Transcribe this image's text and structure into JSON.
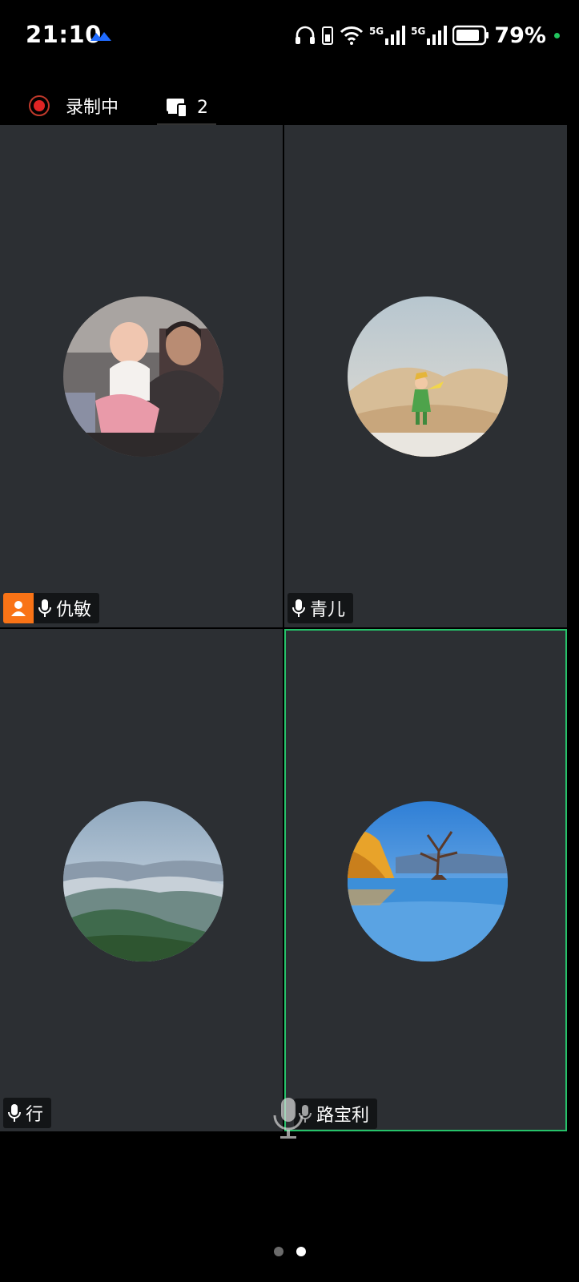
{
  "status_bar": {
    "time": "21:10",
    "battery_percent": "79%",
    "network_1": "5G",
    "network_2": "5G"
  },
  "meeting_bar": {
    "recording_label": "录制中",
    "share_count": "2"
  },
  "participants": [
    {
      "name": "仇敏",
      "is_host": true,
      "speaking": false
    },
    {
      "name": "青儿",
      "is_host": false,
      "speaking": false
    },
    {
      "name": "行",
      "is_host": false,
      "speaking": false
    },
    {
      "name": "路宝利",
      "is_host": false,
      "speaking": true
    }
  ],
  "pager": {
    "total_pages": 2,
    "current_page": 2
  },
  "colors": {
    "tile_bg": "#2c2f33",
    "active_border": "#26c26a",
    "host_badge": "#f97316",
    "recording": "#e02424",
    "battery_dot": "#22c55e"
  }
}
